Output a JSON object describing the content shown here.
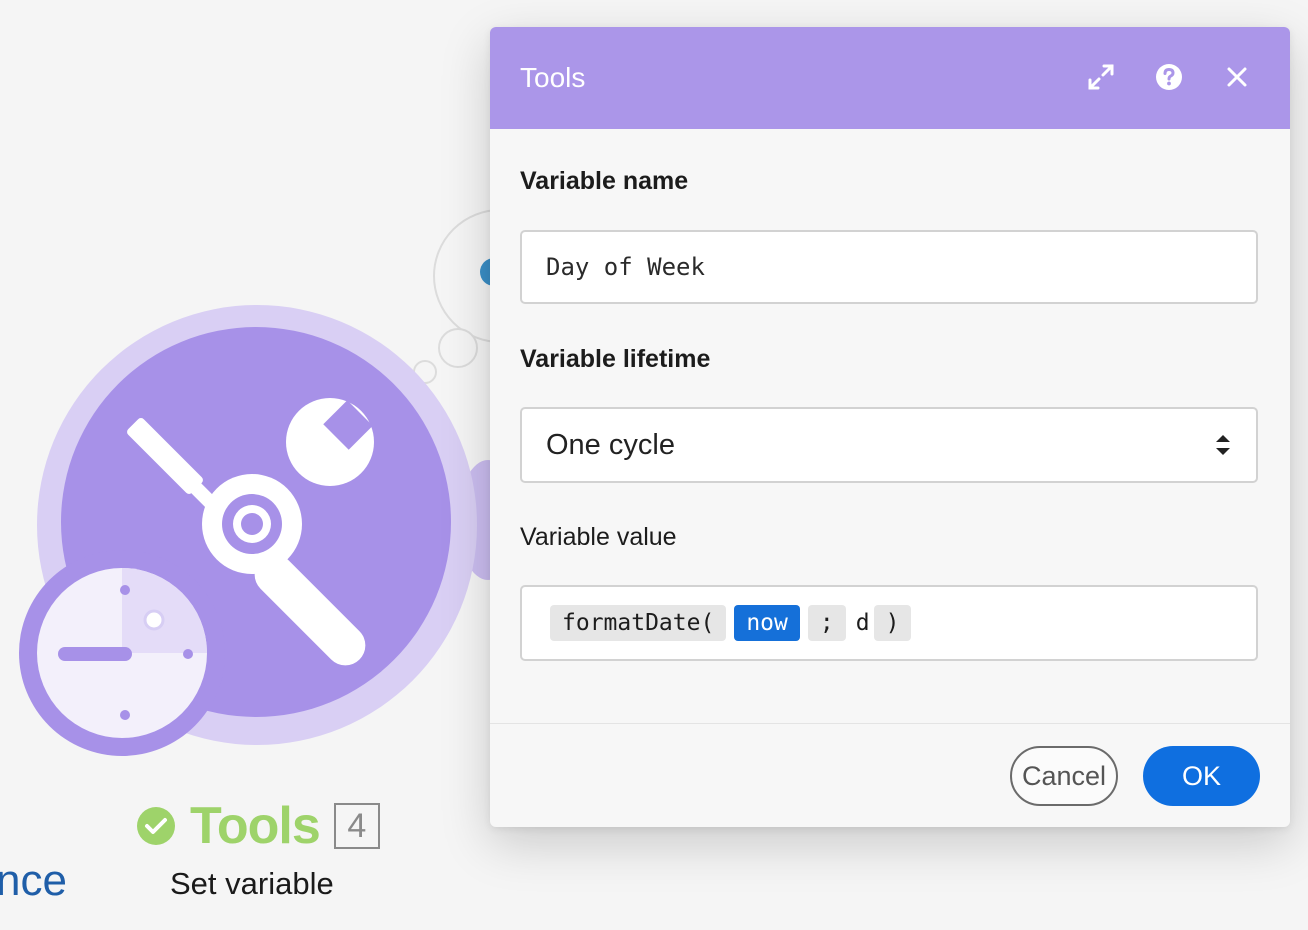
{
  "background": {
    "module": {
      "name": "Tools",
      "badge": "4",
      "subtitle": "Set variable",
      "left_partial_text": "nce",
      "color": "#ab96e9",
      "status": "success"
    }
  },
  "dialog": {
    "title": "Tools",
    "header_icons": [
      "expand-icon",
      "help-icon",
      "close-icon"
    ],
    "fields": {
      "variable_name_label": "Variable name",
      "variable_name_value": "Day of Week",
      "variable_lifetime_label": "Variable lifetime",
      "variable_lifetime_value": "One cycle",
      "variable_value_label": "Variable value",
      "variable_value_tokens": {
        "fn": "formatDate(",
        "now": "now",
        "sep": ";",
        "arg": "d",
        "close": ")"
      }
    },
    "footer": {
      "cancel_label": "Cancel",
      "ok_label": "OK"
    }
  },
  "colors": {
    "header": "#ab96e9",
    "primary": "#0f6fe0",
    "success": "#9ed36a"
  }
}
